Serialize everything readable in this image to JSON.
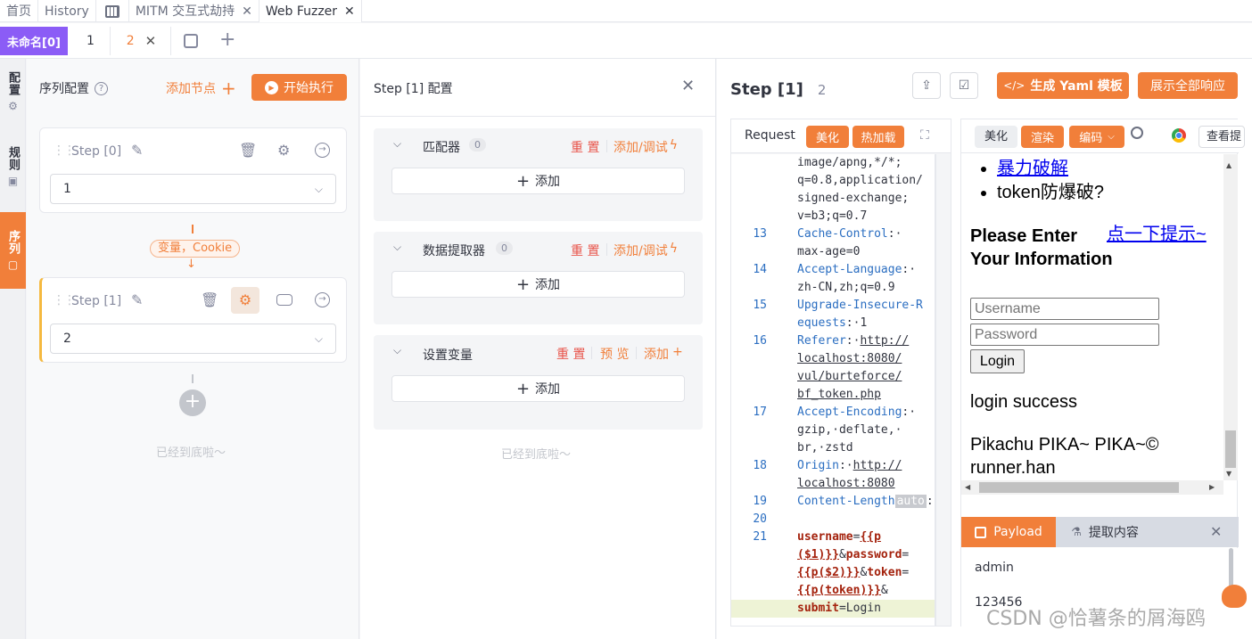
{
  "top_tabs": [
    {
      "label": "首页"
    },
    {
      "label": "History"
    },
    {
      "label": ""
    },
    {
      "label": "MITM 交互式劫持"
    },
    {
      "label": "Web Fuzzer"
    }
  ],
  "sub_tabs": {
    "group": "未命名[0]",
    "tabs": [
      "1",
      "2"
    ]
  },
  "rail": {
    "config": "配置",
    "rules": "规则",
    "sequence": "序列"
  },
  "sequence_panel": {
    "title": "序列配置",
    "add_node": "添加节点",
    "start": "开始执行",
    "steps": [
      {
        "name": "Step [0]",
        "value": "1"
      },
      {
        "name": "Step [1]",
        "value": "2"
      }
    ],
    "connector_tag": "变量，Cookie",
    "bottom": "已经到底啦～"
  },
  "step_config": {
    "title": "Step [1] 配置",
    "sections": [
      {
        "title": "匹配器",
        "count": "0",
        "reset": "重 置",
        "action": "添加/调试",
        "add": "添加"
      },
      {
        "title": "数据提取器",
        "count": "0",
        "reset": "重 置",
        "action": "添加/调试",
        "add": "添加"
      },
      {
        "title": "设置变量",
        "reset": "重 置",
        "preview": "预 览",
        "action": "添加",
        "add": "添加"
      }
    ],
    "bottom": "已经到底啦～"
  },
  "step_view": {
    "title": "Step [1]",
    "num": "2",
    "yaml_btn": "生成 Yaml 模板",
    "show_all": "展示全部响应",
    "request_tab": "Request",
    "beautify": "美化",
    "hot_reload": "热加载",
    "code": [
      {
        "ln": "",
        "parts": [
          {
            "t": "image/apng,*/*;",
            "c": ""
          }
        ]
      },
      {
        "ln": "",
        "parts": [
          {
            "t": "q=0.8,application/",
            "c": ""
          }
        ]
      },
      {
        "ln": "",
        "parts": [
          {
            "t": "signed-exchange;",
            "c": ""
          }
        ]
      },
      {
        "ln": "",
        "parts": [
          {
            "t": "v=b3;q=0.7",
            "c": ""
          }
        ]
      },
      {
        "ln": "13",
        "parts": [
          {
            "t": "Cache-Control",
            "c": "kw"
          },
          {
            "t": ":·",
            "c": ""
          }
        ]
      },
      {
        "ln": "",
        "parts": [
          {
            "t": "max-age=0",
            "c": ""
          }
        ]
      },
      {
        "ln": "14",
        "parts": [
          {
            "t": "Accept-Language",
            "c": "kw"
          },
          {
            "t": ":·",
            "c": ""
          }
        ]
      },
      {
        "ln": "",
        "parts": [
          {
            "t": "zh-CN,zh;q=0.9",
            "c": ""
          }
        ]
      },
      {
        "ln": "15",
        "parts": [
          {
            "t": "Upgrade-Insecure-R",
            "c": "kw"
          }
        ]
      },
      {
        "ln": "",
        "parts": [
          {
            "t": "equests",
            "c": "kw"
          },
          {
            "t": ":·1",
            "c": ""
          }
        ]
      },
      {
        "ln": "16",
        "parts": [
          {
            "t": "Referer",
            "c": "kw"
          },
          {
            "t": ":·",
            "c": ""
          },
          {
            "t": "http://",
            "c": "ul"
          }
        ]
      },
      {
        "ln": "",
        "parts": [
          {
            "t": "localhost:8080/",
            "c": "ul"
          }
        ]
      },
      {
        "ln": "",
        "parts": [
          {
            "t": "vul/burteforce/",
            "c": "ul"
          }
        ]
      },
      {
        "ln": "",
        "parts": [
          {
            "t": "bf_token.php",
            "c": "ul"
          }
        ]
      },
      {
        "ln": "17",
        "parts": [
          {
            "t": "Accept-Encoding",
            "c": "kw"
          },
          {
            "t": ":·",
            "c": ""
          }
        ]
      },
      {
        "ln": "",
        "parts": [
          {
            "t": "gzip,·deflate,·",
            "c": ""
          }
        ]
      },
      {
        "ln": "",
        "parts": [
          {
            "t": "br,·zstd",
            "c": ""
          }
        ]
      },
      {
        "ln": "18",
        "parts": [
          {
            "t": "Origin",
            "c": "kw"
          },
          {
            "t": ":·",
            "c": ""
          },
          {
            "t": "http://",
            "c": "ul"
          }
        ]
      },
      {
        "ln": "",
        "parts": [
          {
            "t": "localhost:8080",
            "c": "ul"
          }
        ]
      },
      {
        "ln": "19",
        "parts": [
          {
            "t": "Content-Length",
            "c": "kw"
          },
          {
            "t": "auto",
            "c": "auto"
          },
          {
            "t": ":",
            "c": ""
          }
        ]
      },
      {
        "ln": "20",
        "parts": [
          {
            "t": "",
            "c": ""
          }
        ]
      },
      {
        "ln": "21",
        "parts": [
          {
            "t": "username",
            "c": "orange"
          },
          {
            "t": "=",
            "c": ""
          },
          {
            "t": "{{p",
            "c": "pl"
          }
        ]
      },
      {
        "ln": "",
        "parts": [
          {
            "t": "($1)}}",
            "c": "pl"
          },
          {
            "t": "&",
            "c": ""
          },
          {
            "t": "password",
            "c": "orange"
          },
          {
            "t": "=",
            "c": ""
          }
        ]
      },
      {
        "ln": "",
        "parts": [
          {
            "t": "{{p($2)}}",
            "c": "pl"
          },
          {
            "t": "&",
            "c": ""
          },
          {
            "t": "token",
            "c": "orange"
          },
          {
            "t": "=",
            "c": ""
          }
        ]
      },
      {
        "ln": "",
        "parts": [
          {
            "t": "{{p(token)}}",
            "c": "pl"
          },
          {
            "t": "&",
            "c": ""
          }
        ]
      },
      {
        "ln": "",
        "parts": [
          {
            "t": "submit",
            "c": "orange"
          },
          {
            "t": "=Login",
            "c": ""
          }
        ]
      }
    ],
    "response_toolbar": {
      "beautify": "美化",
      "render": "渲染",
      "encode": "编码",
      "view": "查看提"
    },
    "rendered": {
      "links": [
        "暴力破解"
      ],
      "bullet2": "token防爆破?",
      "heading_line1": "Please Enter",
      "heading_line2": "Your Information",
      "hint_link": "点一下提示~",
      "username_ph": "Username",
      "password_ph": "Password",
      "login_btn": "Login",
      "result": "login success",
      "footer_line1": "Pikachu PIKA~ PIKA~©",
      "footer_line2": "runner.han"
    },
    "payload_tab": "Payload",
    "extract_tab": "提取内容",
    "payloads": [
      "admin",
      "123456"
    ]
  },
  "watermark": "CSDN @恰薯条的屑海鸥",
  "colors": {
    "accent": "#f17f3a",
    "purple": "#8b5cf6",
    "link_blue": "#2b6ec1"
  }
}
